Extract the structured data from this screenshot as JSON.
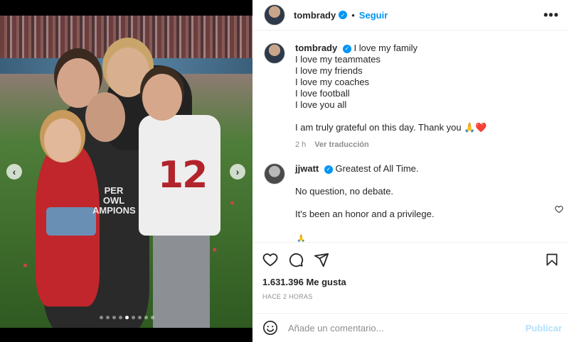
{
  "post": {
    "author": "tombrady",
    "follow_label": "Seguir",
    "separator": "•",
    "more_label": "•••",
    "carousel": {
      "prev": "‹",
      "next": "›",
      "slides": 9,
      "active": 4
    }
  },
  "caption": {
    "author": "tombrady",
    "lines": [
      "I love my family",
      "I love my teammates",
      "I love my friends",
      "I love my coaches",
      "I love football",
      "I love you all"
    ],
    "closing": "I am truly grateful on this day. Thank you 🙏❤️",
    "time": "2 h",
    "translate_label": "Ver traducción"
  },
  "comment": {
    "author": "jjwatt",
    "line1": "Greatest of All Time.",
    "line2": "No question, no debate.",
    "line3": "It's been an honor and a privilege.",
    "folded": "🙏"
  },
  "stats": {
    "likes": "1.631.396 Me gusta",
    "time_ago": "HACE 2 HORAS"
  },
  "composer": {
    "placeholder": "Añade un comentario...",
    "publish_label": "Publicar"
  },
  "icons": {
    "verified": "✓",
    "heart": "heart-icon",
    "comment": "comment-icon",
    "share": "share-icon",
    "save": "save-icon",
    "emoji": "emoji-icon"
  },
  "colors": {
    "accent": "#0095f6",
    "publish_disabled": "#b2dffc",
    "muted": "#8e8e8e"
  },
  "photo": {
    "jersey_number": "12",
    "shirt_text_1": "PER",
    "shirt_text_2": "OWL",
    "shirt_text_3": "AMPIONS"
  }
}
